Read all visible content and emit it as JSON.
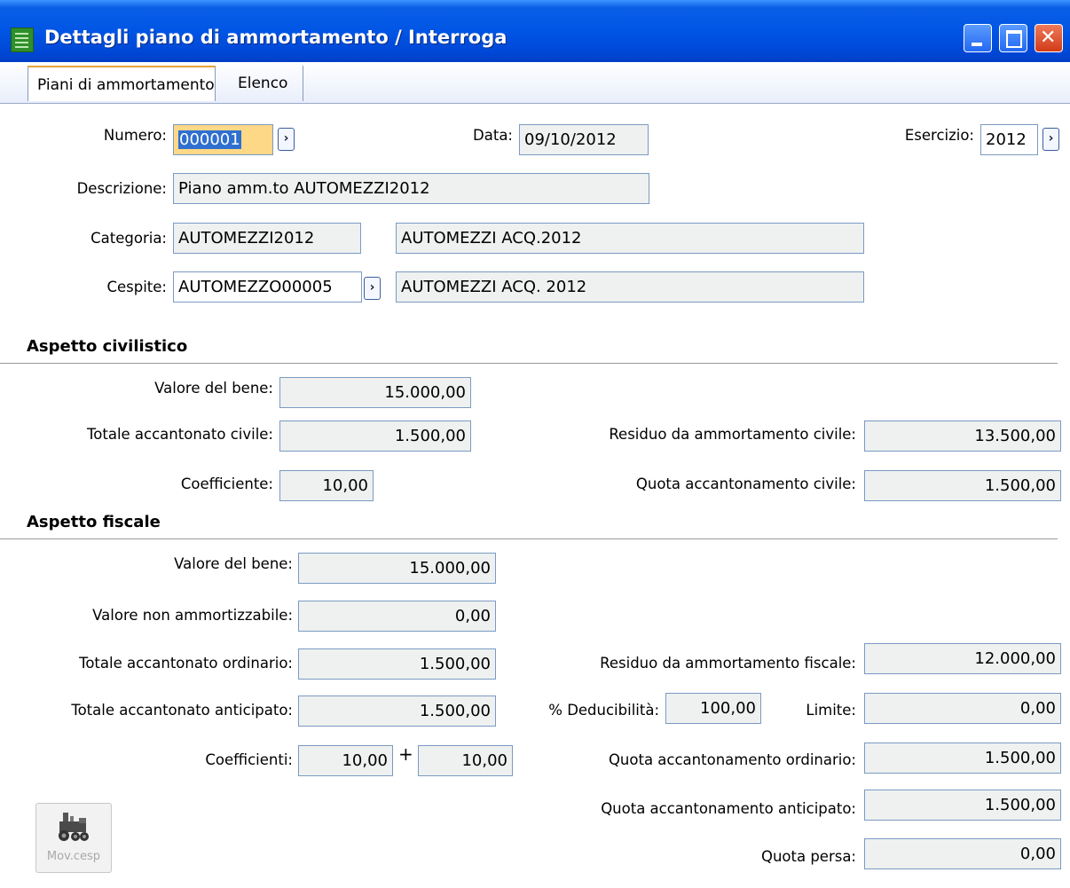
{
  "window": {
    "title": "Dettagli piano di ammortamento / Interroga"
  },
  "tabs": [
    "Piani di ammortamento",
    "Elenco"
  ],
  "header": {
    "numero_label": "Numero:",
    "numero_value": "000001",
    "data_label": "Data:",
    "data_value": "09/10/2012",
    "esercizio_label": "Esercizio:",
    "esercizio_value": "2012",
    "descrizione_label": "Descrizione:",
    "descrizione_value": "Piano amm.to AUTOMEZZI2012",
    "categoria_label": "Categoria:",
    "categoria_code": "AUTOMEZZI2012",
    "categoria_desc": "AUTOMEZZI ACQ.2012",
    "cespite_label": "Cespite:",
    "cespite_code": "AUTOMEZZO00005",
    "cespite_desc": "AUTOMEZZI ACQ. 2012",
    "zoom_glyph": "›"
  },
  "civilistico": {
    "title": "Aspetto civilistico",
    "valore_bene_label": "Valore del bene:",
    "valore_bene": "15.000,00",
    "totale_acc_label": "Totale accantonato civile:",
    "totale_acc": "1.500,00",
    "coefficiente_label": "Coefficiente:",
    "coefficiente": "10,00",
    "residuo_label": "Residuo da ammortamento civile:",
    "residuo": "13.500,00",
    "quota_label": "Quota accantonamento civile:",
    "quota": "1.500,00"
  },
  "fiscale": {
    "title": "Aspetto fiscale",
    "valore_bene_label": "Valore del bene:",
    "valore_bene": "15.000,00",
    "non_amm_label": "Valore non ammortizzabile:",
    "non_amm": "0,00",
    "tot_ord_label": "Totale accantonato ordinario:",
    "tot_ord": "1.500,00",
    "tot_ant_label": "Totale accantonato anticipato:",
    "tot_ant": "1.500,00",
    "coeff_label": "Coefficienti:",
    "coeff1": "10,00",
    "coeff2": "10,00",
    "plus": "+",
    "residuo_label": "Residuo da ammortamento fiscale:",
    "residuo": "12.000,00",
    "deduc_label": "% Deducibilità:",
    "deduc": "100,00",
    "limite_label": "Limite:",
    "limite": "0,00",
    "quota_ord_label": "Quota accantonamento ordinario:",
    "quota_ord": "1.500,00",
    "quota_ant_label": "Quota accantonamento anticipato:",
    "quota_ant": "1.500,00",
    "quota_persa_label": "Quota persa:",
    "quota_persa": "0,00"
  },
  "buttons": {
    "mov_cesp": "Mov.cesp",
    "mov_cesp_icon": "tractor-icon"
  },
  "colors": {
    "titlebar": "#0055e5",
    "field_bg": "#eef1f0",
    "selected_field": "#fdd886",
    "close_button": "#d23b17"
  }
}
